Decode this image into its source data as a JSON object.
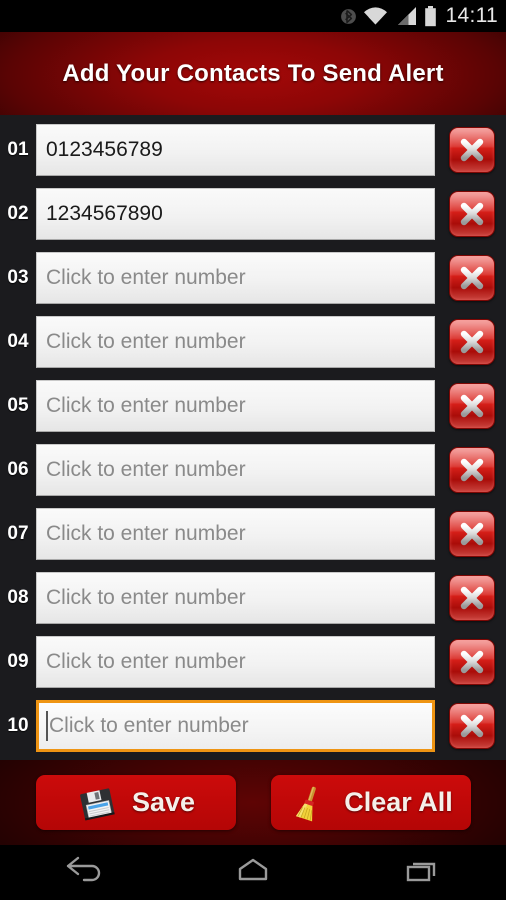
{
  "statusbar": {
    "time": "14:11",
    "icons": [
      {
        "name": "bluetooth-icon"
      },
      {
        "name": "wifi-icon"
      },
      {
        "name": "cellular-signal-icon"
      },
      {
        "name": "battery-icon"
      }
    ]
  },
  "header": {
    "title": "Add Your Contacts To Send Alert"
  },
  "list": {
    "placeholder": "Click to enter number",
    "delete_label": "X",
    "rows": [
      {
        "index": "01",
        "value": "0123456789",
        "focused": false
      },
      {
        "index": "02",
        "value": "1234567890",
        "focused": false
      },
      {
        "index": "03",
        "value": "",
        "focused": false
      },
      {
        "index": "04",
        "value": "",
        "focused": false
      },
      {
        "index": "05",
        "value": "",
        "focused": false
      },
      {
        "index": "06",
        "value": "",
        "focused": false
      },
      {
        "index": "07",
        "value": "",
        "focused": false
      },
      {
        "index": "08",
        "value": "",
        "focused": false
      },
      {
        "index": "09",
        "value": "",
        "focused": false
      },
      {
        "index": "10",
        "value": "",
        "focused": true
      }
    ]
  },
  "actions": {
    "save_label": "Save",
    "save_icon": "floppy-disk-icon",
    "clear_label": "Clear All",
    "clear_icon": "broom-icon"
  },
  "navbar": {
    "back": "back-icon",
    "home": "home-icon",
    "recents": "recents-icon"
  },
  "colors": {
    "header_red": "#8d0606",
    "button_red": "#c00808",
    "focus_orange": "#ee9413",
    "background": "#1b1b1e",
    "field": "#f2f2f2"
  }
}
